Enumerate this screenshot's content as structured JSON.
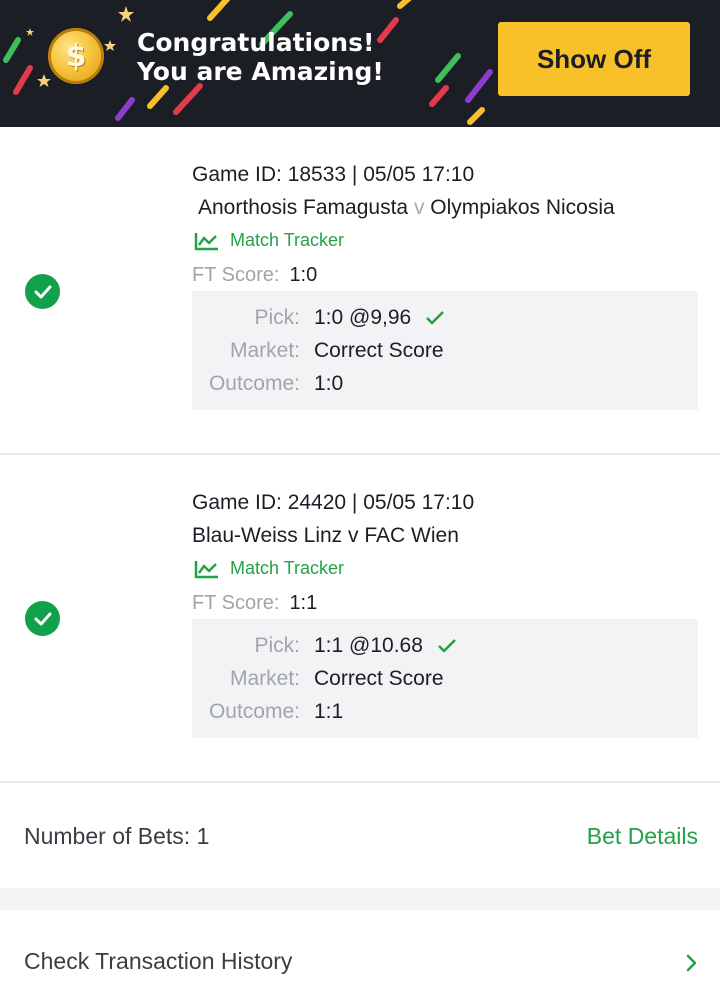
{
  "banner": {
    "title_line1": "Congratulations!",
    "title_line2": "You are Amazing!",
    "show_off_label": "Show Off",
    "coin_symbol": "$",
    "accent_color": "#f8c12a",
    "background_color": "#1b1e25"
  },
  "bets": [
    {
      "game_id": "Game ID: 18533 | 05/05 17:10",
      "home": "Anorthosis Famagusta",
      "vs": "v",
      "away": "Olympiakos Nicosia",
      "tracker_label": "Match Tracker",
      "ft_label": "FT Score:",
      "ft_value": "1:0",
      "pick_label": "Pick:",
      "pick_value": "1:0 @9,96",
      "market_label": "Market:",
      "market_value": "Correct Score",
      "outcome_label": "Outcome:",
      "outcome_value": "1:0",
      "status": "won"
    },
    {
      "game_id": "Game ID: 24420 | 05/05 17:10",
      "home": "Blau-Weiss Linz",
      "vs": "v",
      "away": "FAC Wien",
      "tracker_label": "Match Tracker",
      "ft_label": "FT Score:",
      "ft_value": "1:1",
      "pick_label": "Pick:",
      "pick_value": "1:1 @10.68",
      "market_label": "Market:",
      "market_value": "Correct Score",
      "outcome_label": "Outcome:",
      "outcome_value": "1:1",
      "status": "won"
    }
  ],
  "summary": {
    "number_of_bets": "Number of Bets: 1",
    "bet_details_label": "Bet Details"
  },
  "history": {
    "label": "Check Transaction History"
  },
  "icons": {
    "won": "check-circle-icon",
    "pick_ok": "check-icon",
    "tracker": "chart-line-icon",
    "history": "chevron-right-icon"
  },
  "colors": {
    "green": "#12a14b",
    "link_green": "#22a147",
    "muted": "#a1a4ab",
    "panel": "#f2f3f5"
  }
}
